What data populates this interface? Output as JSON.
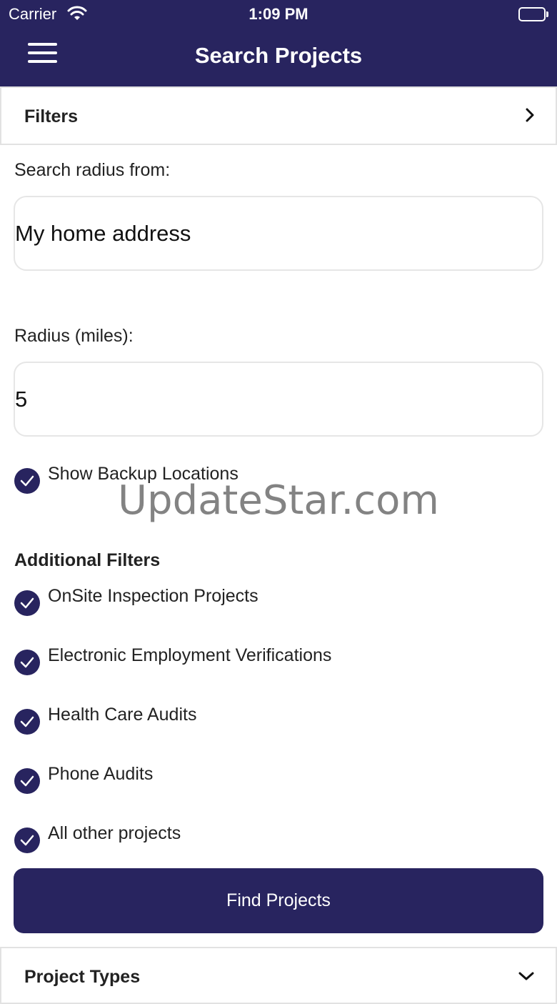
{
  "status_bar": {
    "carrier": "Carrier",
    "time": "1:09 PM"
  },
  "nav": {
    "title": "Search Projects",
    "menu_icon": "hamburger-menu-icon"
  },
  "filters": {
    "label": "Filters",
    "chevron_icon": "chevron-right-icon"
  },
  "search_radius": {
    "label": "Search radius from:",
    "value": "My home address"
  },
  "radius": {
    "label": "Radius (miles):",
    "value": "5"
  },
  "backup": {
    "label": "Show Backup Locations",
    "checked": true
  },
  "additional_filters": {
    "title": "Additional Filters",
    "items": [
      {
        "label": "OnSite Inspection Projects",
        "checked": true
      },
      {
        "label": "Electronic Employment Verifications",
        "checked": true
      },
      {
        "label": "Health Care Audits",
        "checked": true
      },
      {
        "label": "Phone Audits",
        "checked": true
      },
      {
        "label": "All other projects",
        "checked": true
      }
    ]
  },
  "find_button": {
    "label": "Find Projects"
  },
  "project_types": {
    "label": "Project Types",
    "chevron_icon": "chevron-down-icon"
  },
  "watermark": "UpdateStar.com",
  "colors": {
    "primary": "#28245f",
    "border": "#e2e2e2"
  }
}
